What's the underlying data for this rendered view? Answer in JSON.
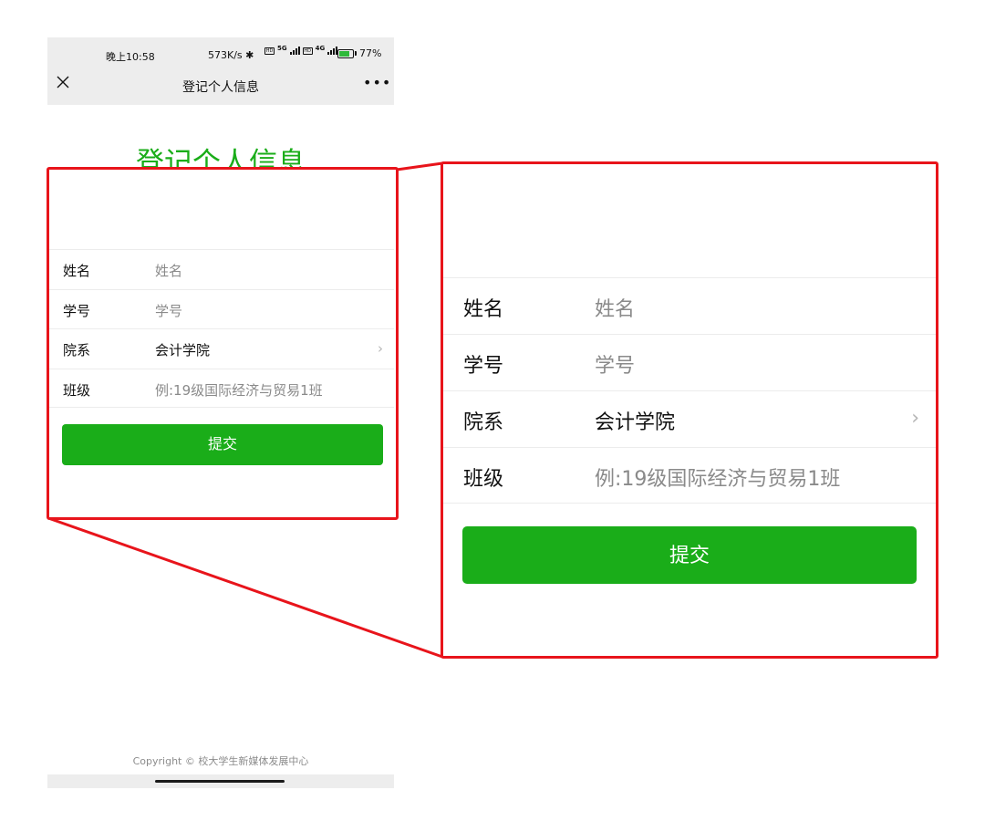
{
  "status_bar": {
    "time": "晚上10:58",
    "network_speed": "573K/s",
    "sim1_type": "5G",
    "sim2_type": "4G",
    "battery_level": 77,
    "battery_text": "77%"
  },
  "nav": {
    "title": "登记个人信息",
    "close_icon": "close-icon",
    "more_icon": "more-dots-icon"
  },
  "page_title": "登记个人信息",
  "form": {
    "fields": [
      {
        "label": "姓名",
        "placeholder": "姓名",
        "value": ""
      },
      {
        "label": "学号",
        "placeholder": "学号",
        "value": ""
      },
      {
        "label": "院系",
        "value": "会计学院",
        "type": "select"
      },
      {
        "label": "班级",
        "placeholder": "例:19级国际经济与贸易1班",
        "value": ""
      }
    ],
    "submit_label": "提交"
  },
  "footer": {
    "copyright": "Copyright © 校大学生新媒体发展中心"
  },
  "colors": {
    "accent": "#1aad19",
    "highlight": "#e8141b",
    "bar_bg": "#ededed"
  }
}
